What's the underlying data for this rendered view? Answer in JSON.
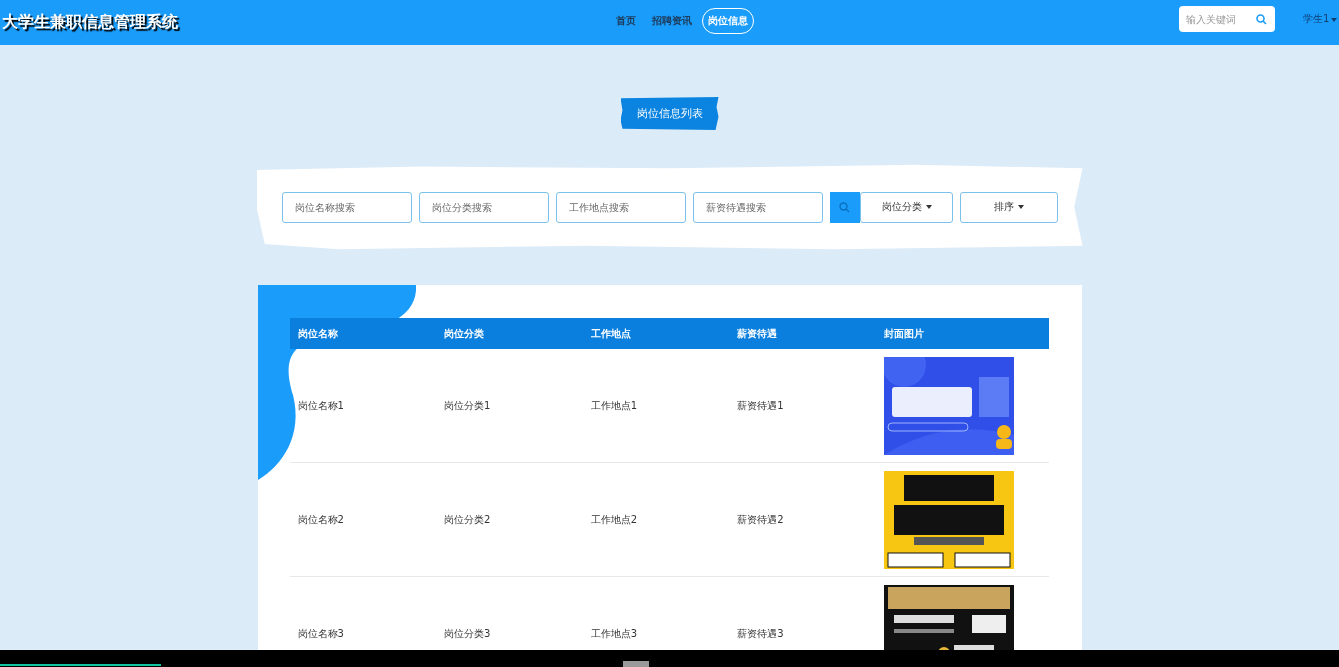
{
  "header": {
    "title": "大学生兼职信息管理系统",
    "nav": [
      {
        "label": "首页",
        "selected": false
      },
      {
        "label": "招聘资讯",
        "selected": false
      },
      {
        "label": "岗位信息",
        "selected": true
      }
    ],
    "search": {
      "placeholder": "输入关键词"
    },
    "user": "学生1"
  },
  "section_title": "岗位信息列表",
  "filters": {
    "fields": [
      {
        "placeholder": "岗位名称搜索"
      },
      {
        "placeholder": "岗位分类搜索"
      },
      {
        "placeholder": "工作地点搜索"
      },
      {
        "placeholder": "薪资待遇搜索"
      }
    ],
    "dropdowns": [
      "岗位分类",
      "排序"
    ]
  },
  "table": {
    "columns": [
      "岗位名称",
      "岗位分类",
      "工作地点",
      "薪资待遇",
      "封面图片"
    ],
    "rows": [
      {
        "cells": [
          "岗位名称1",
          "岗位分类1",
          "工作地点1",
          "薪资待遇1"
        ],
        "cover": {
          "kind": "picture"
        }
      },
      {
        "cells": [
          "岗位名称2",
          "岗位分类2",
          "工作地点2",
          "薪资待遇2"
        ],
        "cover": {
          "kind": "picture"
        }
      },
      {
        "cells": [
          "岗位名称3",
          "岗位分类3",
          "工作地点3",
          "薪资待遇3"
        ],
        "cover": {
          "kind": "picture"
        }
      }
    ]
  },
  "player_bar": {
    "level": 0.12
  }
}
